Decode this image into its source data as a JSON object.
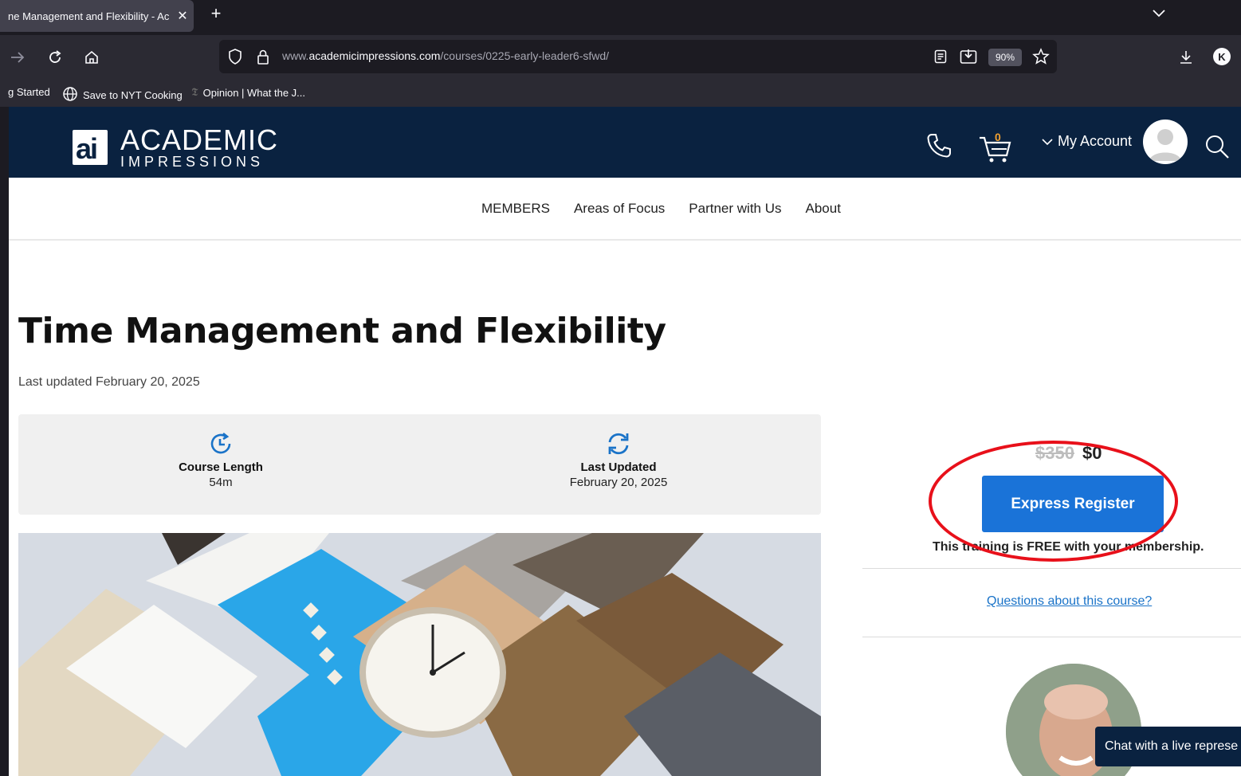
{
  "browser": {
    "tab_title": "ne Management and Flexibility - Ac",
    "tab_close": "✕",
    "new_tab": "+",
    "url_prefix": "www.",
    "url_domain": "academicimpressions.com",
    "url_path": "/courses/0225-early-leader6-sfwd/",
    "zoom": "90%",
    "profile_initial": "K",
    "bookmarks": [
      {
        "label": "g Started"
      },
      {
        "label": "Save to NYT Cooking",
        "icon": "globe-icon"
      },
      {
        "label": "Opinion | What the J...",
        "icon": "nyt-icon"
      }
    ]
  },
  "site": {
    "logo_mark": "ai",
    "logo_line1": "ACADEMIC",
    "logo_line2": "IMPRESSIONS",
    "cart_count": "0",
    "my_account": "My Account",
    "nav": [
      "MEMBERS",
      "Areas of Focus",
      "Partner with Us",
      "About"
    ]
  },
  "course": {
    "title": "Time Management and Flexibility",
    "last_updated_line": "Last updated February 20, 2025",
    "length_label": "Course Length",
    "length_value": "54m",
    "updated_label": "Last Updated",
    "updated_value": "February 20, 2025"
  },
  "sidebar": {
    "price_old": "$350",
    "price_new": "$0",
    "register_label": "Express Register",
    "free_note": "This training is FREE with your membership.",
    "questions_link": "Questions about this course?",
    "chat_label": "Chat with a live represe"
  },
  "colors": {
    "header_bg": "#0a2240",
    "accent_blue": "#1a73d8",
    "annotation_red": "#e8101a"
  }
}
